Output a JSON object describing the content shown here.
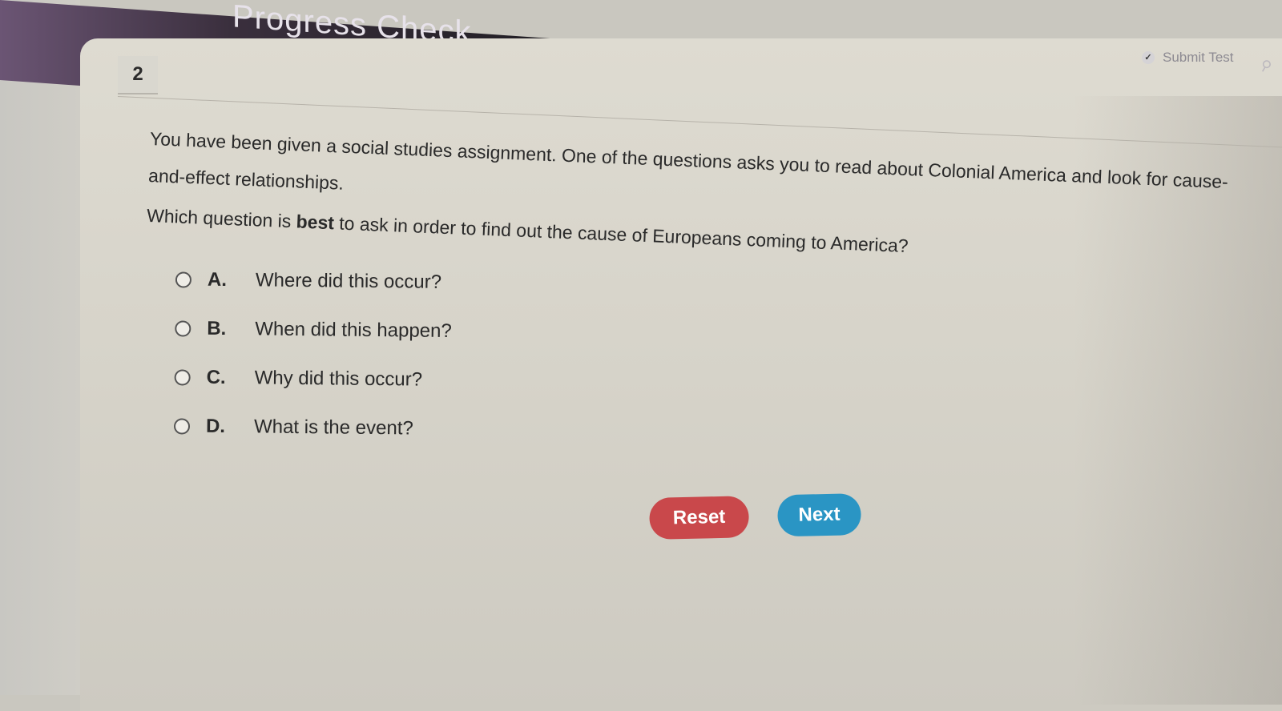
{
  "header": {
    "title": "Progress Check",
    "submit_label": "Submit Test"
  },
  "question": {
    "number": "2",
    "prompt": "You have been given a social studies assignment. One of the questions asks you to read about Colonial America and look for cause-and-effect relationships.",
    "stem_before": "Which question is ",
    "stem_bold": "best",
    "stem_after": " to ask in order to find out the cause of Europeans coming to America?",
    "options": [
      {
        "letter": "A.",
        "text": "Where did this occur?"
      },
      {
        "letter": "B.",
        "text": "When did this happen?"
      },
      {
        "letter": "C.",
        "text": "Why did this occur?"
      },
      {
        "letter": "D.",
        "text": "What is the event?"
      }
    ]
  },
  "buttons": {
    "reset_label": "Reset",
    "next_label": "Next"
  },
  "colors": {
    "reset": "#c9484b",
    "next": "#2a95c4",
    "header": "#1f1d22"
  }
}
